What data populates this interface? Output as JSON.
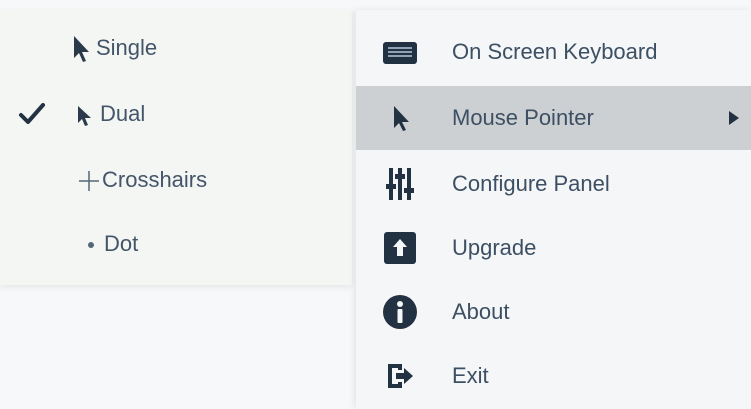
{
  "submenu": {
    "items": [
      {
        "label": "Single",
        "checked": false,
        "icon": "cursor-arrow-icon"
      },
      {
        "label": "Dual",
        "checked": true,
        "icon": "cursor-arrow-small-icon"
      },
      {
        "label": "Crosshairs",
        "checked": false,
        "icon": "crosshair-icon"
      },
      {
        "label": "Dot",
        "checked": false,
        "icon": "dot-icon"
      }
    ]
  },
  "menu": {
    "items": [
      {
        "label": "On Screen Keyboard",
        "icon": "keyboard-icon"
      },
      {
        "label": "Mouse Pointer",
        "icon": "cursor-arrow-icon",
        "has_submenu": true,
        "selected": true
      },
      {
        "label": "Configure Panel",
        "icon": "sliders-icon"
      },
      {
        "label": "Upgrade",
        "icon": "upgrade-icon"
      },
      {
        "label": "About",
        "icon": "info-icon"
      },
      {
        "label": "Exit",
        "icon": "exit-icon"
      }
    ]
  },
  "colors": {
    "icon_dark": "#223242",
    "text": "#3d4f63",
    "highlight": "#cdd0d3",
    "accent_blue": "#3f6f9f"
  }
}
